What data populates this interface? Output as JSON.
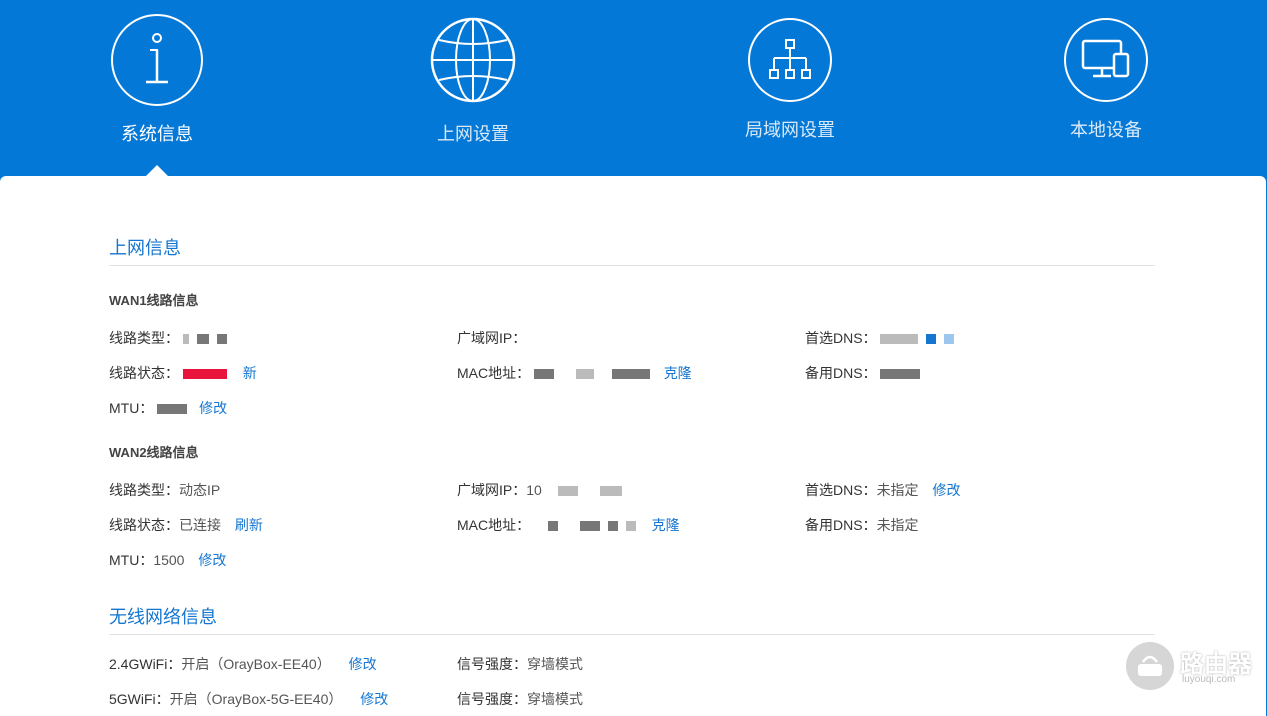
{
  "nav": {
    "items": [
      {
        "label": "系统信息",
        "icon": "info-icon"
      },
      {
        "label": "上网设置",
        "icon": "globe-icon"
      },
      {
        "label": "局域网设置",
        "icon": "network-icon"
      },
      {
        "label": "本地设备",
        "icon": "devices-icon"
      }
    ],
    "active_index": 0
  },
  "internet": {
    "title": "上网信息",
    "wan1": {
      "title": "WAN1线路信息",
      "type_label": "线路类型：",
      "status_label": "线路状态：",
      "status_link": "新",
      "mtu_label": "MTU：",
      "mtu_link": "修改",
      "wan_ip_label": "广域网IP：",
      "mac_label": "MAC地址：",
      "mac_link": "克隆",
      "dns1_label": "首选DNS：",
      "dns2_label": "备用DNS："
    },
    "wan2": {
      "title": "WAN2线路信息",
      "type_label": "线路类型：",
      "type_value": "动态IP",
      "status_label": "线路状态：",
      "status_value": "已连接",
      "status_link": "刷新",
      "mtu_label": "MTU：",
      "mtu_value": "1500",
      "mtu_link": "修改",
      "wan_ip_label": "广域网IP：",
      "wan_ip_partial": "10",
      "mac_label": "MAC地址：",
      "mac_link": "克隆",
      "dns1_label": "首选DNS：",
      "dns1_value": "未指定",
      "dns1_link": "修改",
      "dns2_label": "备用DNS：",
      "dns2_value": "未指定"
    }
  },
  "wireless": {
    "title": "无线网络信息",
    "wifi24_label": "2.4GWiFi：",
    "wifi24_value": "开启（OrayBox-EE40）",
    "wifi24_link": "修改",
    "wifi24_signal_label": "信号强度：",
    "wifi24_signal_value": "穿墙模式",
    "wifi5_label": "5GWiFi：",
    "wifi5_value": "开启（OrayBox-5G-EE40）",
    "wifi5_link": "修改",
    "wifi5_signal_label": "信号强度：",
    "wifi5_signal_value": "穿墙模式"
  },
  "watermark": {
    "text": "路由器",
    "sub": "luyouqi.com"
  },
  "colors": {
    "header_blue": "#0478d7",
    "link_blue": "#1476d0"
  }
}
